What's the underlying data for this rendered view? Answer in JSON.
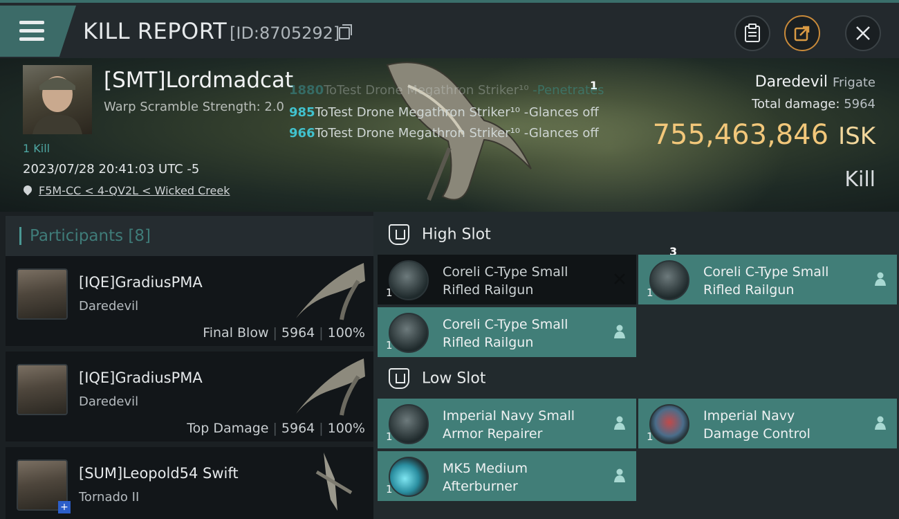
{
  "header": {
    "title": "KILL REPORT",
    "report_id": "[ID:8705292]"
  },
  "victim": {
    "name": "[SMT]Lordmadcat",
    "warp_scramble": "Warp Scramble Strength: 2.0",
    "kills": "1 Kill",
    "timestamp": "2023/07/28 20:41:03 UTC -5",
    "location": "F5M-CC < 4-QV2L < Wicked Creek"
  },
  "hit_log": [
    {
      "damage": "1880",
      "text": "ToTest Drone Megathron Striker¹⁰",
      "result": "-Penetrates"
    },
    {
      "damage": "985",
      "text": "ToTest Drone Megathron Striker¹⁰",
      "result": "-Glances off"
    },
    {
      "damage": "966",
      "text": "ToTest Drone Megathron Striker¹⁰",
      "result": "-Glances off"
    }
  ],
  "markers": {
    "hit_marker": "1",
    "slot_marker": "3"
  },
  "ship": {
    "name": "Daredevil",
    "class": "Frigate",
    "total_damage_label": "Total damage:",
    "total_damage": "5964",
    "isk_value": "755,463,846",
    "isk_unit": "ISK",
    "outcome": "Kill"
  },
  "participants": {
    "title": "Participants",
    "count": "[8]",
    "items": [
      {
        "name": "[IQE]GradiusPMA",
        "ship": "Daredevil",
        "role": "Final Blow",
        "damage": "5964",
        "percent": "100%"
      },
      {
        "name": "[IQE]GradiusPMA",
        "ship": "Daredevil",
        "role": "Top Damage",
        "damage": "5964",
        "percent": "100%"
      },
      {
        "name": "[SUM]Leopold54 Swift",
        "ship": "Tornado II",
        "badge": "+"
      }
    ]
  },
  "fitting": {
    "high_slot_label": "High Slot",
    "low_slot_label": "Low Slot",
    "high_slots": [
      {
        "qty": "1",
        "line1": "Coreli C-Type Small",
        "line2": "Rifled Railgun",
        "state": "destroyed"
      },
      {
        "qty": "1",
        "line1": "Coreli C-Type Small",
        "line2": "Rifled Railgun",
        "state": "dropped"
      },
      {
        "qty": "1",
        "line1": "Coreli C-Type Small",
        "line2": "Rifled Railgun",
        "state": "dropped"
      }
    ],
    "low_slots": [
      {
        "qty": "1",
        "line1": "Imperial Navy Small",
        "line2": "Armor Repairer",
        "state": "dropped"
      },
      {
        "qty": "1",
        "line1": "Imperial Navy",
        "line2": "Damage Control",
        "state": "dropped"
      },
      {
        "qty": "1",
        "line1": "MK5 Medium",
        "line2": "Afterburner",
        "state": "dropped"
      }
    ]
  },
  "colors": {
    "accent_teal": "#417e78",
    "isk_gold": "#f2c77a",
    "hit_damage": "#41c2ce"
  }
}
